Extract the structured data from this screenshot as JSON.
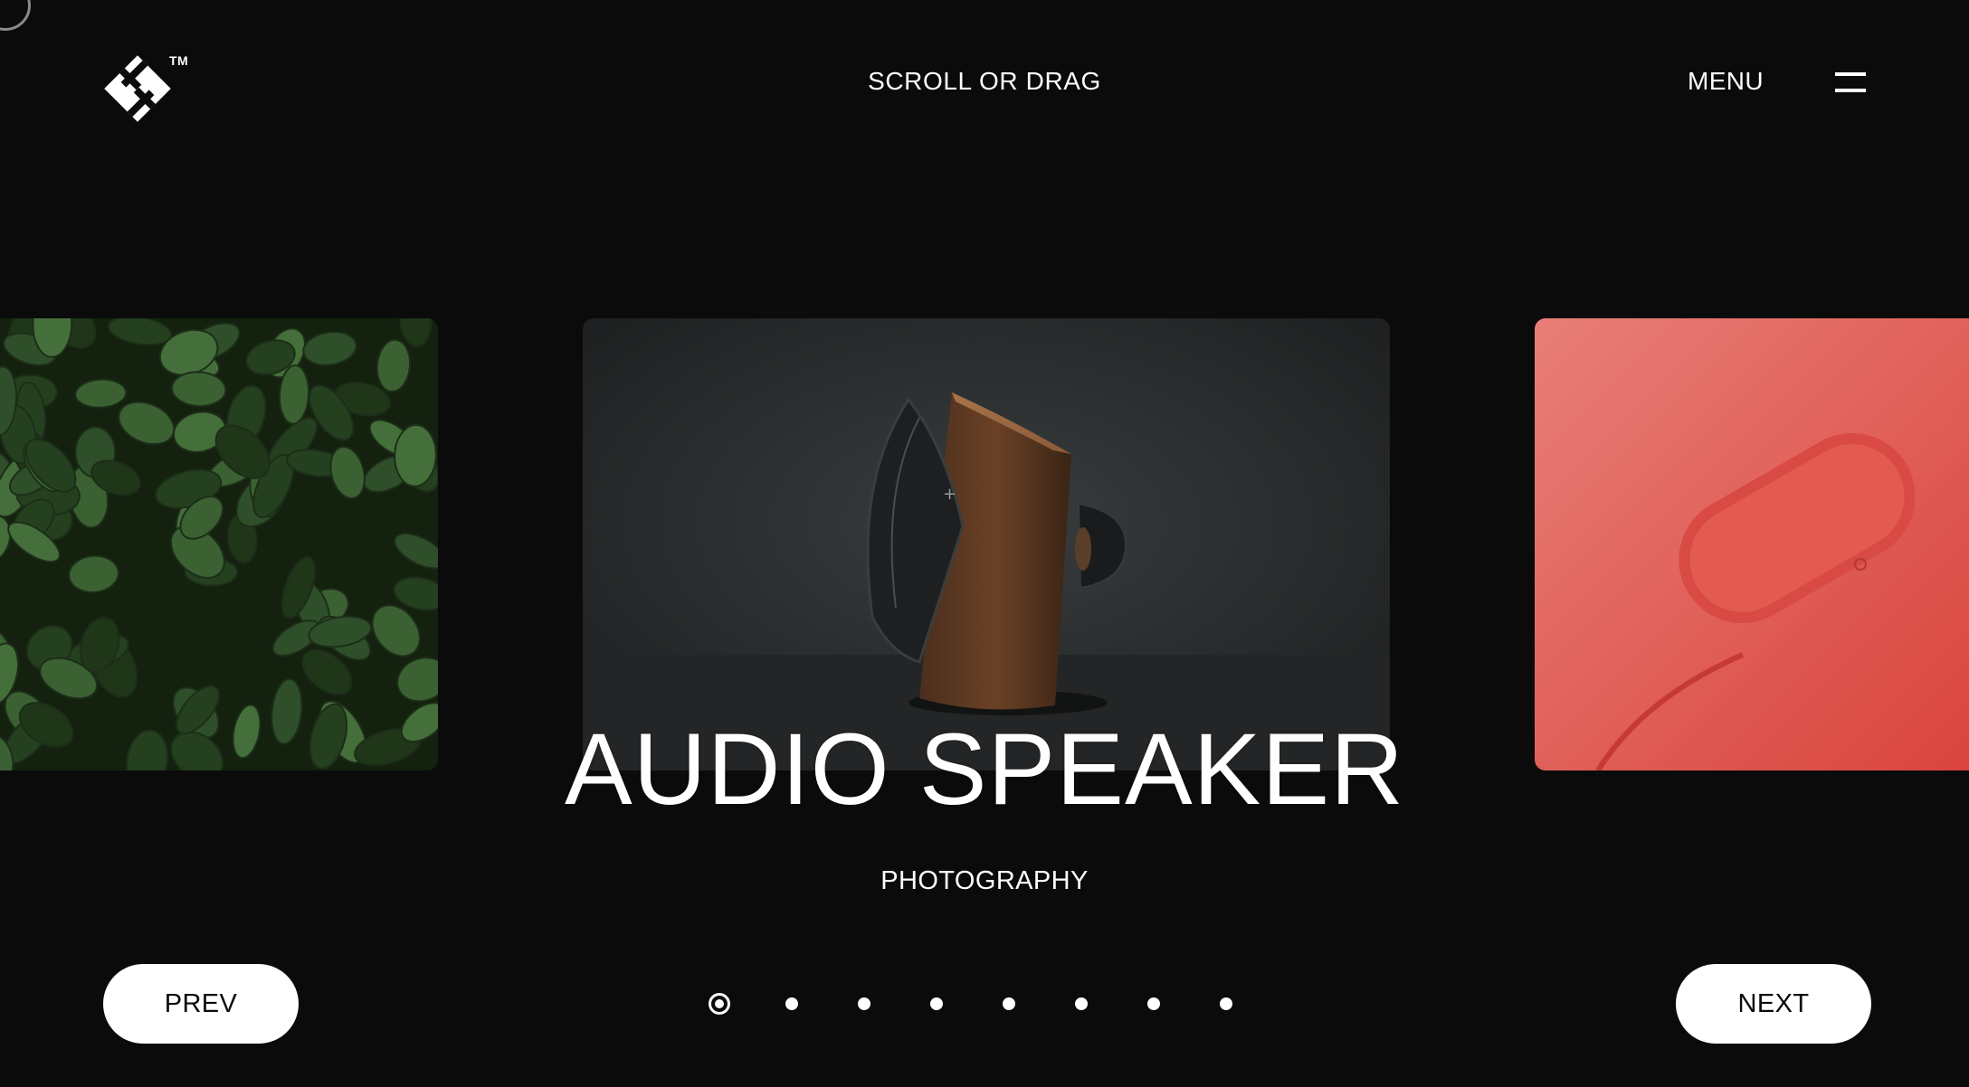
{
  "header": {
    "logo_mark": "TM",
    "scroll_hint": "SCROLL OR DRAG",
    "menu_label": "MENU"
  },
  "icons": {
    "logo": "brand-logo-icon",
    "menu": "hamburger-icon",
    "cursor": "cursor-ring-icon"
  },
  "slider": {
    "slides": [
      {
        "subject": "leaves",
        "dominant_color": "#2e4a2a"
      },
      {
        "subject": "speaker",
        "dominant_color": "#26292a"
      },
      {
        "subject": "charger",
        "dominant_color": "#e05550"
      }
    ],
    "active_index": 1,
    "title": "AUDIO SPEAKER",
    "category": "PHOTOGRAPHY",
    "page_count": 8,
    "current_page": 1
  },
  "nav": {
    "prev_label": "PREV",
    "next_label": "NEXT"
  },
  "colors": {
    "background": "#0b0b0b",
    "text": "#ffffff",
    "button_bg": "#ffffff",
    "button_text": "#0b0b0b"
  }
}
